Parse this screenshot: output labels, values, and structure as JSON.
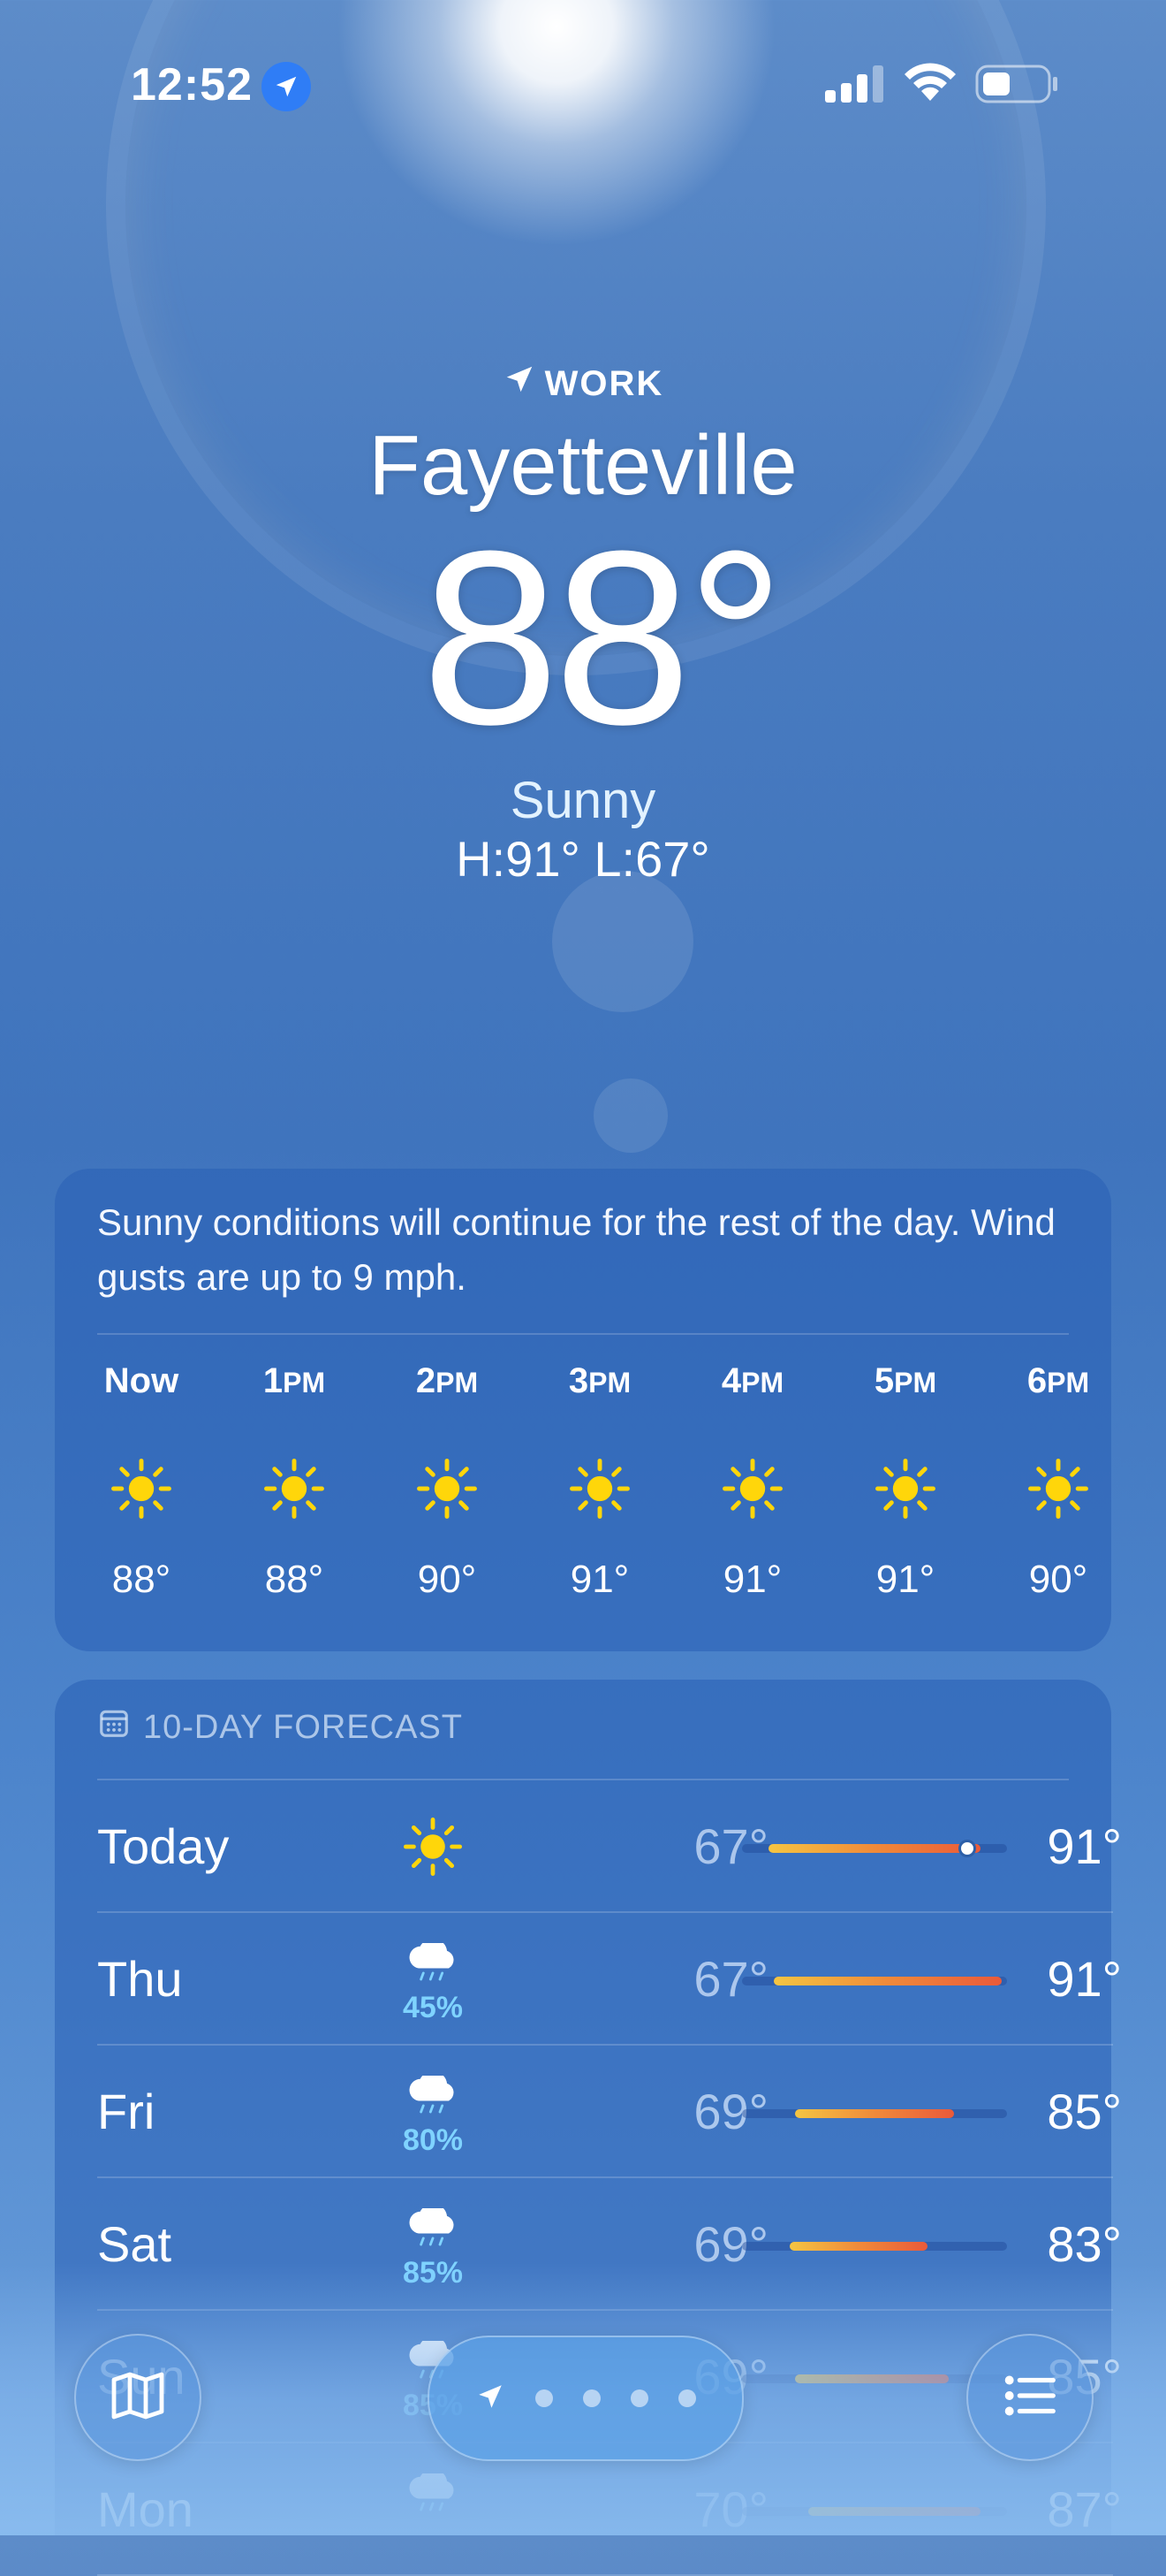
{
  "status": {
    "time": "12:52"
  },
  "header": {
    "location_label": "WORK",
    "city": "Fayetteville",
    "temperature": "88°",
    "condition": "Sunny",
    "hilo": "H:91°  L:67°"
  },
  "hourly": {
    "summary": "Sunny conditions will continue for the rest of the day. Wind gusts are up to 9 mph.",
    "hours": [
      {
        "time": "Now",
        "suffix": "",
        "temp": "88°",
        "icon": "sun-icon"
      },
      {
        "time": "1",
        "suffix": "PM",
        "temp": "88°",
        "icon": "sun-icon"
      },
      {
        "time": "2",
        "suffix": "PM",
        "temp": "90°",
        "icon": "sun-icon"
      },
      {
        "time": "3",
        "suffix": "PM",
        "temp": "91°",
        "icon": "sun-icon"
      },
      {
        "time": "4",
        "suffix": "PM",
        "temp": "91°",
        "icon": "sun-icon"
      },
      {
        "time": "5",
        "suffix": "PM",
        "temp": "91°",
        "icon": "sun-icon"
      },
      {
        "time": "6",
        "suffix": "PM",
        "temp": "90°",
        "icon": "sun-icon"
      }
    ]
  },
  "forecast": {
    "title": "10-DAY FORECAST",
    "days": [
      {
        "day": "Today",
        "icon": "sun-icon",
        "pop": "",
        "low": "67°",
        "high": "91°",
        "range": [
          0.1,
          0.9
        ],
        "current": 0.85
      },
      {
        "day": "Thu",
        "icon": "rain-cloud-icon",
        "pop": "45%",
        "low": "67°",
        "high": "91°",
        "range": [
          0.12,
          0.98
        ]
      },
      {
        "day": "Fri",
        "icon": "rain-cloud-icon",
        "pop": "80%",
        "low": "69°",
        "high": "85°",
        "range": [
          0.2,
          0.8
        ]
      },
      {
        "day": "Sat",
        "icon": "rain-cloud-icon",
        "pop": "85%",
        "low": "69°",
        "high": "83°",
        "range": [
          0.18,
          0.7
        ]
      },
      {
        "day": "Sun",
        "icon": "rain-cloud-icon",
        "pop": "85%",
        "low": "69°",
        "high": "85°",
        "range": [
          0.2,
          0.78
        ]
      },
      {
        "day": "Mon",
        "icon": "rain-cloud-icon",
        "pop": "",
        "low": "70°",
        "high": "87°",
        "range": [
          0.25,
          0.9
        ]
      }
    ]
  },
  "colors": {
    "accent": "#2f7df6",
    "pop": "#7fd3ff",
    "sun": "#ffd60a"
  }
}
